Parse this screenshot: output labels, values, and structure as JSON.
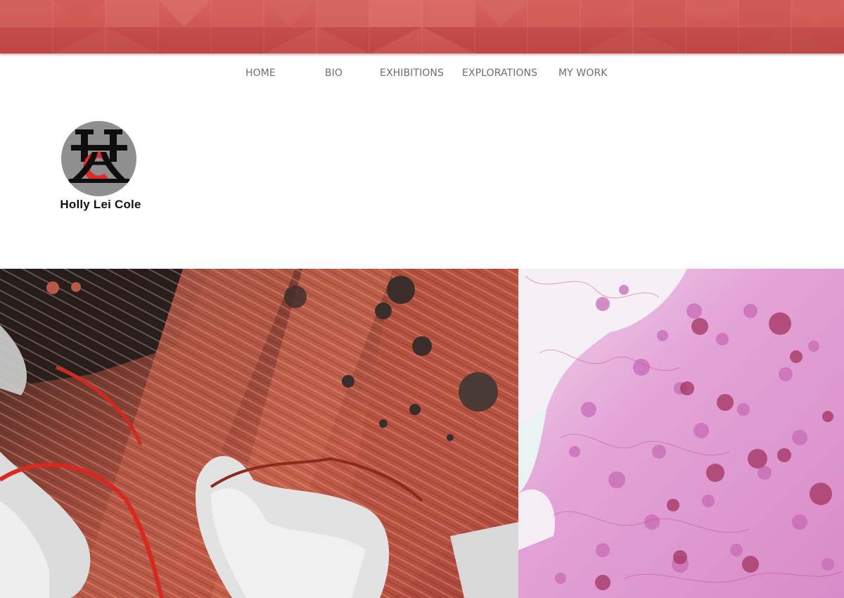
{
  "site": {
    "name": "Holly Lei Cole",
    "logo_icon": "hc-monogram-icon"
  },
  "nav": {
    "items": [
      {
        "label": "HOME"
      },
      {
        "label": "BIO"
      },
      {
        "label": "EXHIBITIONS"
      },
      {
        "label": "EXPLORATIONS"
      },
      {
        "label": "MY WORK"
      }
    ]
  },
  "colors": {
    "banner": "#cf5854",
    "nav_text": "#6e6e6e",
    "logo_circle": "#8f8f8f",
    "logo_accent": "#e02a2a"
  },
  "gallery": [
    {
      "name": "artwork-red-abstract",
      "palette": [
        "#b5523f",
        "#2a201e",
        "#e6e6e6",
        "#d9281f"
      ]
    },
    {
      "name": "artwork-pink-watercolor",
      "palette": [
        "#e7a8d8",
        "#c85fae",
        "#a4335f",
        "#f6eef6"
      ]
    }
  ]
}
